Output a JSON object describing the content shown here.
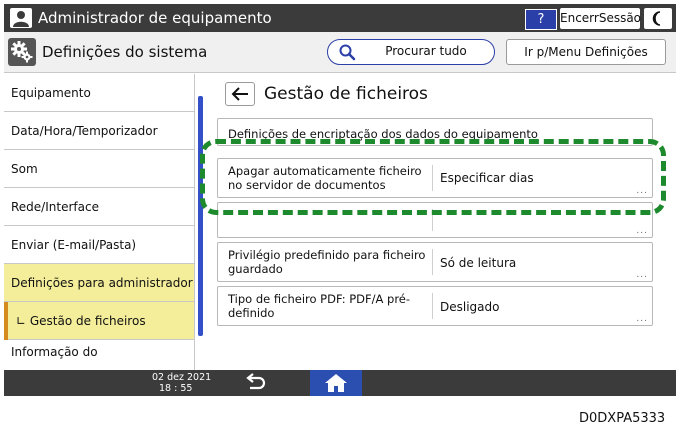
{
  "titlebar": {
    "title": "Administrador de equipamento",
    "help_label": "?",
    "logout_label": "EncerrSessão",
    "user_icon": "user-icon",
    "moon_icon": "moon-icon"
  },
  "header": {
    "section_title": "Definições do sistema",
    "search_label": "Procurar tudo",
    "goto_label": "Ir p/Menu Definições",
    "section_icon": "gears-icon"
  },
  "sidebar": {
    "items": [
      {
        "label": "Equipamento"
      },
      {
        "label": "Data/Hora/Temporizador"
      },
      {
        "label": "Som"
      },
      {
        "label": "Rede/Interface"
      },
      {
        "label": "Enviar (E-mail/Pasta)"
      },
      {
        "label": "Definições para administrador",
        "selected": true
      },
      {
        "label": "∟ Gestão de ficheiros",
        "selected": true
      },
      {
        "label": "Informação do"
      }
    ]
  },
  "main": {
    "title": "Gestão de ficheiros",
    "rows": [
      {
        "label": "Definições de encriptação dos dados do equipamento",
        "value": ""
      },
      {
        "label": "Apagar automaticamente ficheiro no servidor de documentos",
        "value": "Especificar dias"
      },
      {
        "label": "",
        "value": ""
      },
      {
        "label": "Privilégio predefinido para ficheiro guardado",
        "value": "Só de leitura"
      },
      {
        "label": "Tipo de ficheiro PDF: PDF/A pré-definido",
        "value": "Desligado"
      }
    ],
    "more_indicator": "..."
  },
  "footer": {
    "date": "02 dez 2021",
    "time": "18 : 55",
    "return_icon": "return-icon",
    "home_icon": "home-icon"
  },
  "document_code": "D0DXPA5333",
  "colors": {
    "bar_dark": "#3b3b3b",
    "accent_blue": "#2b3fa8",
    "selected_yellow": "#f4ee9a",
    "highlight_green": "#1e8a2e"
  }
}
